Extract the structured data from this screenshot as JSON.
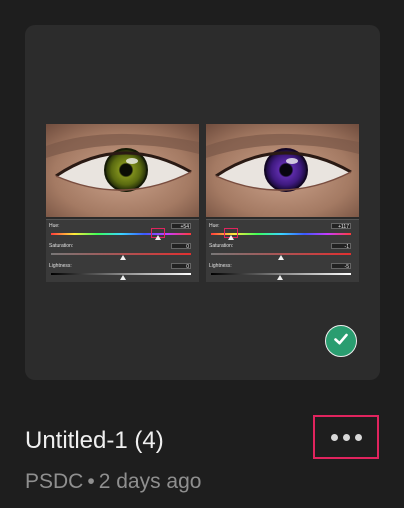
{
  "file": {
    "title": "Untitled-1 (4)",
    "source": "PSDC",
    "separator": "•",
    "modified": "2 days ago"
  },
  "thumbnail": {
    "panels": [
      {
        "eye_color": "green",
        "hue_label": "Hue:",
        "hue_value": "+54",
        "hue_level": 0.78,
        "saturation_label": "Saturation:",
        "saturation_value": "0",
        "saturation_level": 0.5,
        "lightness_label": "Lightness:",
        "lightness_value": "0",
        "lightness_level": 0.5
      },
      {
        "eye_color": "purple",
        "hue_label": "Hue:",
        "hue_value": "+117",
        "hue_level": 0.14,
        "saturation_label": "Saturation:",
        "saturation_value": "-1",
        "saturation_level": 0.49,
        "lightness_label": "Lightness:",
        "lightness_value": "-5",
        "lightness_level": 0.48
      }
    ]
  },
  "status": {
    "icon": "checkmark-icon",
    "color": "#2a9d70"
  },
  "actions": {
    "more_icon": "more-horizontal-icon",
    "highlight_color": "#e0245e"
  }
}
